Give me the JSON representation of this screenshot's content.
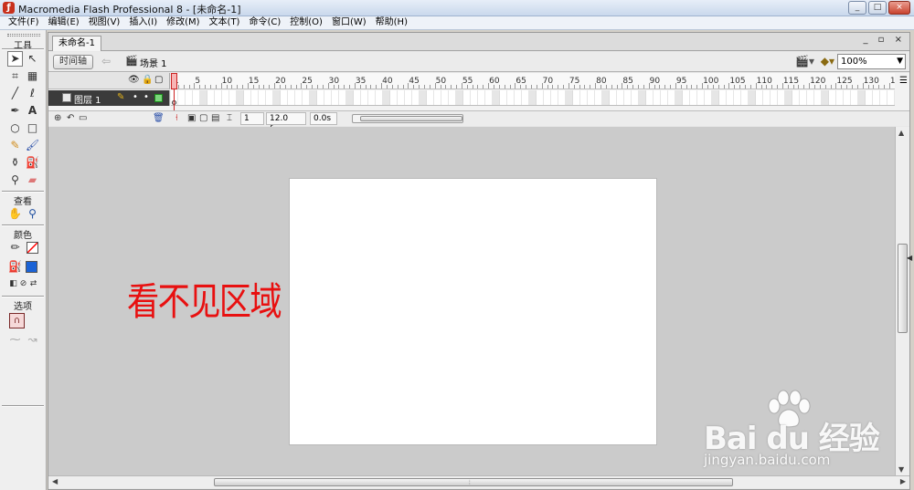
{
  "window": {
    "app_icon": "flash-icon",
    "title": "Macromedia Flash Professional 8 - [未命名-1]",
    "controls": [
      "_",
      "□",
      "×"
    ]
  },
  "menu": [
    "文件(F)",
    "编辑(E)",
    "视图(V)",
    "插入(I)",
    "修改(M)",
    "文本(T)",
    "命令(C)",
    "控制(O)",
    "窗口(W)",
    "帮助(H)"
  ],
  "toolbox": {
    "tools_heading": "工具",
    "view_heading": "查看",
    "colors_heading": "颜色",
    "options_heading": "选项",
    "tools": [
      "arrow-icon",
      "subselect-icon",
      "free-transform-icon",
      "fill-transform-icon",
      "line-icon",
      "lasso-icon",
      "pen-icon",
      "text-icon",
      "oval-icon",
      "rectangle-icon",
      "pencil-icon",
      "brush-icon",
      "ink-bottle-icon",
      "paint-bucket-icon",
      "eyedropper-icon",
      "eraser-icon",
      "hand-icon",
      "zoom-icon"
    ],
    "stroke_color": "#ff0000",
    "fill_color": "#1b63d6"
  },
  "document": {
    "tab_label": "未命名-1",
    "tab_controls": "_ ▫ ×",
    "timeline_button": "时间轴",
    "scene_label": "场景 1",
    "zoom": "100%"
  },
  "timeline": {
    "ruler": [
      "1",
      "5",
      "10",
      "15",
      "20",
      "25",
      "30",
      "35",
      "40",
      "45",
      "50",
      "55",
      "60",
      "65",
      "70",
      "75",
      "80",
      "85",
      "90",
      "95",
      "100",
      "105",
      "110",
      "115",
      "120",
      "125",
      "130",
      "1"
    ],
    "layer_name": "图层 1",
    "current_frame": "1",
    "frame_rate": "12.0 fps",
    "elapsed": "0.0s"
  },
  "stage": {
    "annotation": "看不见区域",
    "annotation_color": "#e81010",
    "background": "#ffffff"
  },
  "watermark": {
    "brand": "Bai du 经验",
    "url": "jingyan.baidu.com"
  }
}
